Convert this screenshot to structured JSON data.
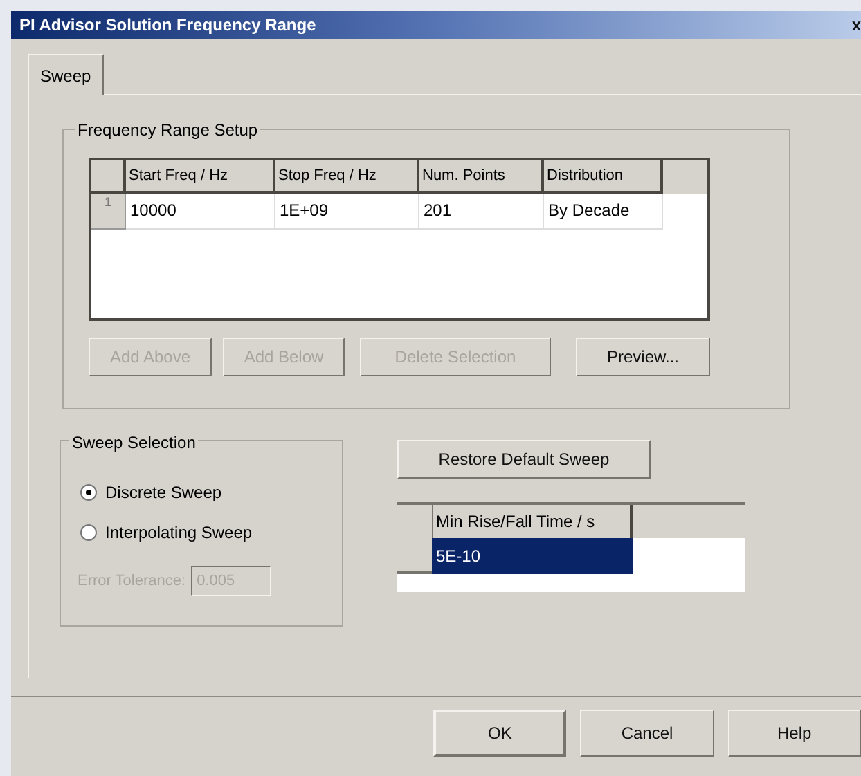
{
  "window": {
    "title": "PI Advisor Solution Frequency Range",
    "close": "x"
  },
  "tabs": [
    {
      "label": "Sweep",
      "selected": true
    }
  ],
  "frequency_range_setup": {
    "title": "Frequency Range Setup",
    "table": {
      "columns": [
        "Start Freq / Hz",
        "Stop Freq / Hz",
        "Num. Points",
        "Distribution"
      ],
      "rows": [
        {
          "header": "1",
          "cells": [
            "10000",
            "1E+09",
            "201",
            "By Decade"
          ]
        }
      ]
    },
    "buttons": [
      {
        "label": "Add Above",
        "disabled": true
      },
      {
        "label": "Add Below",
        "disabled": true
      },
      {
        "label": "Delete Selection",
        "disabled": true
      },
      {
        "label": "Preview...",
        "disabled": false
      }
    ]
  },
  "sweep_selection": {
    "title": "Sweep Selection",
    "options": [
      {
        "label": "Discrete Sweep",
        "selected": true
      },
      {
        "label": "Interpolating Sweep",
        "selected": false
      }
    ],
    "error_tolerance": {
      "label": "Error Tolerance:",
      "value": "0.005",
      "disabled": true
    }
  },
  "restore_button": "Restore Default Sweep",
  "rise_time_table": {
    "column": "Min Rise/Fall Time / s",
    "rows": [
      {
        "value": "5E-10",
        "selected": true
      }
    ]
  },
  "dialog_buttons": [
    "OK",
    "Cancel",
    "Help"
  ]
}
